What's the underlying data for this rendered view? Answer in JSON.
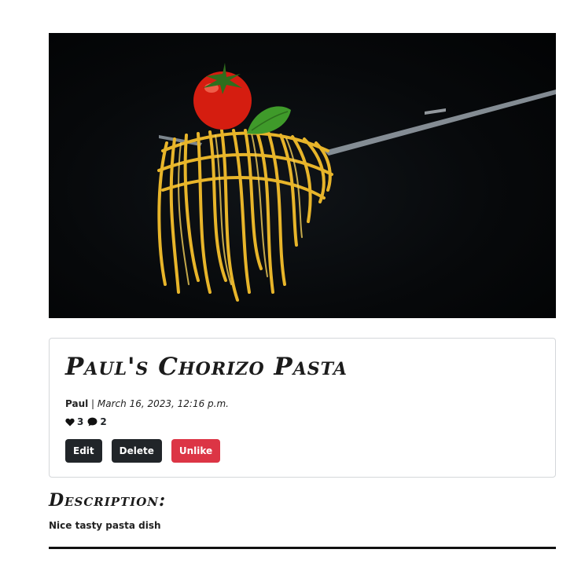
{
  "post": {
    "image_alt": "Spaghetti twirled on a fork topped with a tomato and basil leaf",
    "title": "Paul's Chorizo Pasta",
    "author": "Paul",
    "separator": " | ",
    "date": "March 16, 2023, 12:16 p.m.",
    "likes": "3",
    "comments": "2"
  },
  "icons": {
    "likes": "heart-icon",
    "comments": "comment-icon"
  },
  "actions": {
    "edit_label": "Edit",
    "delete_label": "Delete",
    "unlike_label": "Unlike"
  },
  "description": {
    "heading": "Description:",
    "text": "Nice tasty pasta dish"
  },
  "colors": {
    "dark_button": "#212529",
    "unlike_button": "#dc3545"
  }
}
